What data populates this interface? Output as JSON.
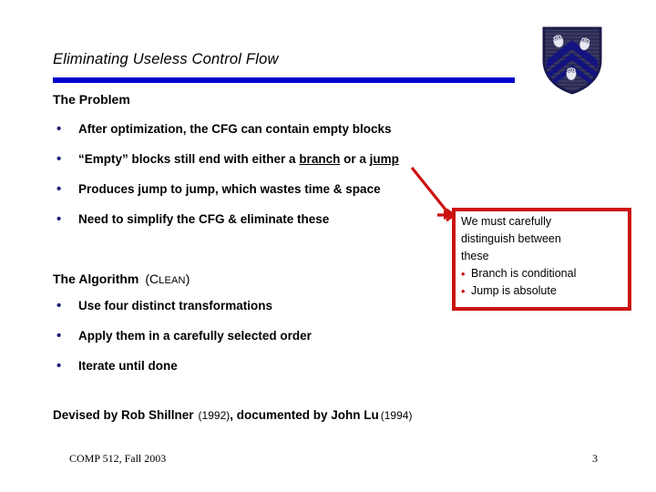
{
  "slide": {
    "title": "Eliminating Useless Control Flow",
    "accent_color": "#0000CC",
    "bullet_color": "#1F1F7A",
    "callout_color": "#CC1111"
  },
  "problem": {
    "heading": "The Problem",
    "bullets": [
      {
        "text": "After optimization, the CFG can contain empty blocks"
      },
      {
        "text_before": "“Empty” blocks still end with either a ",
        "underline_1": "branch",
        "text_mid": " or a ",
        "underline_2": "jump"
      },
      {
        "text": "Produces jump to jump, which wastes time & space"
      },
      {
        "text": "Need to simplify the CFG & eliminate these"
      }
    ]
  },
  "algorithm": {
    "heading": "The Algorithm",
    "paren_open": "(C",
    "paren_smallcaps": "LEAN",
    "paren_close": ")",
    "bullets": [
      {
        "text": "Use four distinct transformations"
      },
      {
        "text": "Apply them in a carefully selected order"
      },
      {
        "text": "Iterate until done"
      }
    ]
  },
  "callout": {
    "line_1": "We must carefully",
    "line_2": "distinguish between",
    "line_3": "these",
    "sub_bullets": [
      {
        "text": "Branch is conditional"
      },
      {
        "text": "Jump is absolute"
      }
    ]
  },
  "attribution": {
    "part_1": "Devised by Rob Shillner",
    "year_1": "(1992)",
    "part_2": ", documented by John Lu",
    "year_2": "(1994)"
  },
  "footer": {
    "course": "COMP 512, Fall 2003",
    "page_number": "3"
  },
  "icons": {
    "bullet_glyph": "•",
    "shield": "rice-shield-logo",
    "arrow": "callout-pointer-arrow"
  }
}
